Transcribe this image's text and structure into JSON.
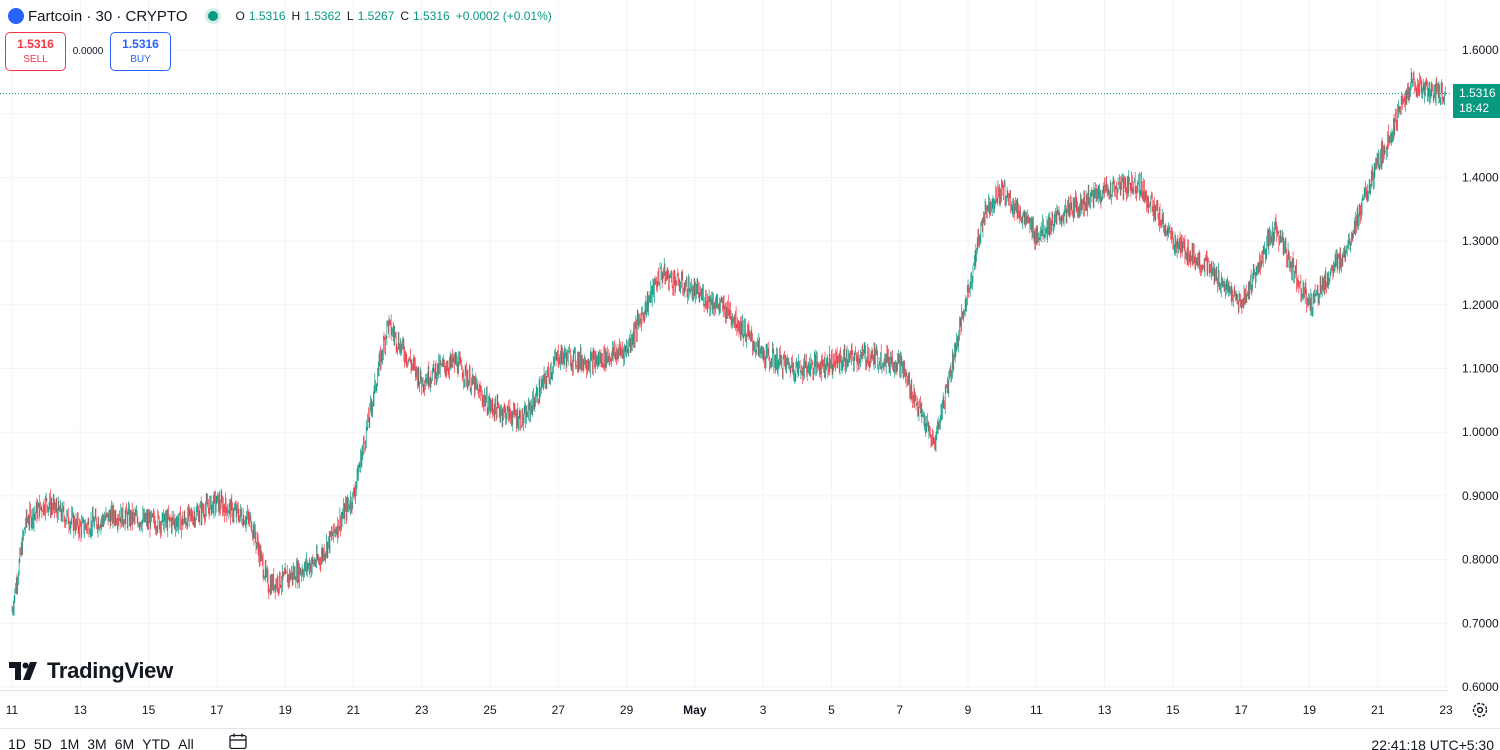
{
  "header": {
    "symbol": "Fartcoin · 30 · CRYPTO",
    "ohlc": {
      "open_label": "O",
      "open": "1.5316",
      "high_label": "H",
      "high": "1.5362",
      "low_label": "L",
      "low": "1.5267",
      "close_label": "C",
      "close": "1.5316",
      "change": "+0.0002 (+0.01%)"
    }
  },
  "trade": {
    "sell_price": "1.5316",
    "sell_label": "SELL",
    "spread": "0.0000",
    "buy_price": "1.5316",
    "buy_label": "BUY"
  },
  "price_badge": {
    "price": "1.5316",
    "countdown": "18:42"
  },
  "branding": {
    "logo_text": "TradingView"
  },
  "bottom_bar": {
    "ranges": [
      "1D",
      "5D",
      "1M",
      "3M",
      "6M",
      "YTD",
      "All"
    ],
    "clock": "22:41:18 UTC+5:30"
  },
  "colors": {
    "up": "#089981",
    "down": "#f23645",
    "accent": "#2962ff"
  },
  "chart_data": {
    "type": "candlestick",
    "title": "",
    "xlabel": "",
    "ylabel": "",
    "ylim": [
      0.6,
      1.6
    ],
    "y_ticks": [
      "0.6000",
      "0.7000",
      "0.8000",
      "0.9000",
      "1.0000",
      "1.1000",
      "1.2000",
      "1.3000",
      "1.4000",
      "1.5000",
      "1.6000"
    ],
    "x_ticks": [
      "11",
      "13",
      "15",
      "17",
      "19",
      "21",
      "23",
      "25",
      "27",
      "29",
      "May",
      "3",
      "5",
      "7",
      "9",
      "11",
      "13",
      "15",
      "17",
      "19",
      "21",
      "23"
    ],
    "x_range": [
      "Apr 11",
      "May 23"
    ],
    "grid": true,
    "last_price": 1.5316,
    "series": [
      {
        "name": "Fartcoin",
        "days": [
          0,
          0.4,
          1,
          2,
          3,
          4,
          5,
          6,
          7,
          7.5,
          8,
          9,
          10,
          11,
          12,
          12.5,
          13,
          14,
          15,
          16,
          17,
          18,
          19,
          20,
          21,
          22,
          23,
          24,
          25,
          26,
          27,
          28,
          28.5,
          29,
          30,
          31,
          32,
          33,
          34,
          35,
          36,
          37,
          38,
          39,
          40,
          41,
          41.5,
          42
        ],
        "close": [
          0.72,
          0.86,
          0.89,
          0.85,
          0.87,
          0.86,
          0.86,
          0.89,
          0.86,
          0.76,
          0.77,
          0.8,
          0.9,
          1.17,
          1.08,
          1.1,
          1.11,
          1.04,
          1.02,
          1.12,
          1.11,
          1.13,
          1.25,
          1.22,
          1.19,
          1.12,
          1.1,
          1.11,
          1.12,
          1.11,
          0.98,
          1.22,
          1.35,
          1.38,
          1.31,
          1.35,
          1.38,
          1.39,
          1.3,
          1.26,
          1.2,
          1.32,
          1.2,
          1.28,
          1.42,
          1.55,
          1.535,
          1.5316
        ]
      }
    ]
  }
}
